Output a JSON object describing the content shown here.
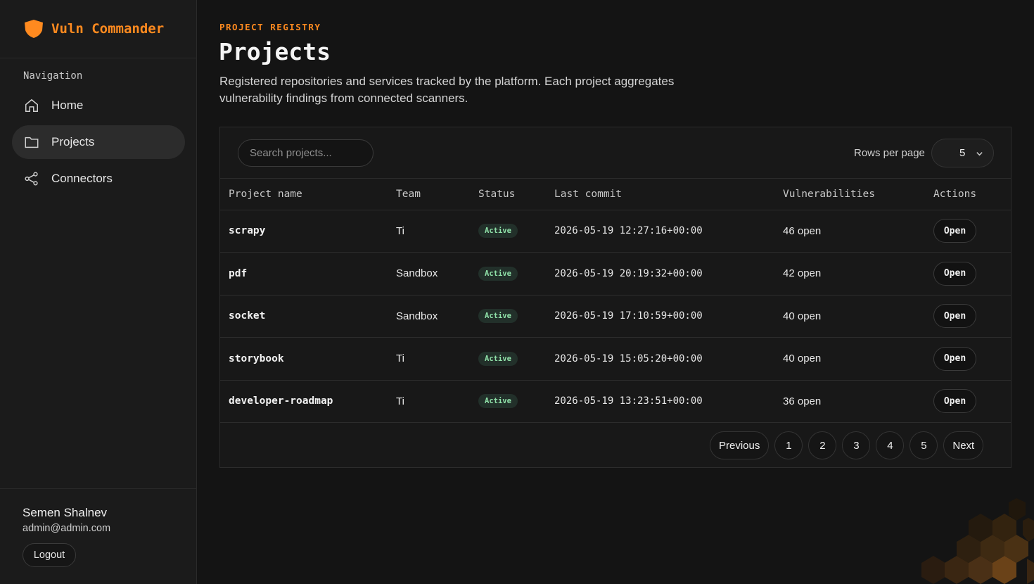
{
  "brand": {
    "name": "Vuln Commander",
    "accent": "#ff8a1f"
  },
  "sidebar": {
    "heading": "Navigation",
    "items": [
      {
        "label": "Home",
        "icon": "home-icon"
      },
      {
        "label": "Projects",
        "icon": "folder-icon",
        "active": true
      },
      {
        "label": "Connectors",
        "icon": "share-icon"
      }
    ],
    "user": {
      "name": "Semen Shalnev",
      "email": "admin@admin.com"
    },
    "logout_label": "Logout"
  },
  "header": {
    "eyebrow": "PROJECT REGISTRY",
    "title": "Projects",
    "description": "Registered repositories and services tracked by the platform. Each project aggregates vulnerability findings from connected scanners."
  },
  "toolbar": {
    "search_placeholder": "Search projects...",
    "rows_label": "Rows per page",
    "rows_value": "5"
  },
  "table": {
    "columns": [
      "Project name",
      "Team",
      "Status",
      "Last commit",
      "Vulnerabilities",
      "Actions"
    ],
    "rows": [
      {
        "name": "scrapy",
        "team": "Ti",
        "status": "Active",
        "commit": "2026-05-19 12:27:16+00:00",
        "vulns": "46 open",
        "action": "Open"
      },
      {
        "name": "pdf",
        "team": "Sandbox",
        "status": "Active",
        "commit": "2026-05-19 20:19:32+00:00",
        "vulns": "42 open",
        "action": "Open"
      },
      {
        "name": "socket",
        "team": "Sandbox",
        "status": "Active",
        "commit": "2026-05-19 17:10:59+00:00",
        "vulns": "40 open",
        "action": "Open"
      },
      {
        "name": "storybook",
        "team": "Ti",
        "status": "Active",
        "commit": "2026-05-19 15:05:20+00:00",
        "vulns": "40 open",
        "action": "Open"
      },
      {
        "name": "developer-roadmap",
        "team": "Ti",
        "status": "Active",
        "commit": "2026-05-19 13:23:51+00:00",
        "vulns": "36 open",
        "action": "Open"
      }
    ]
  },
  "pagination": {
    "previous": "Previous",
    "pages": [
      "1",
      "2",
      "3",
      "4",
      "5"
    ],
    "next": "Next"
  }
}
